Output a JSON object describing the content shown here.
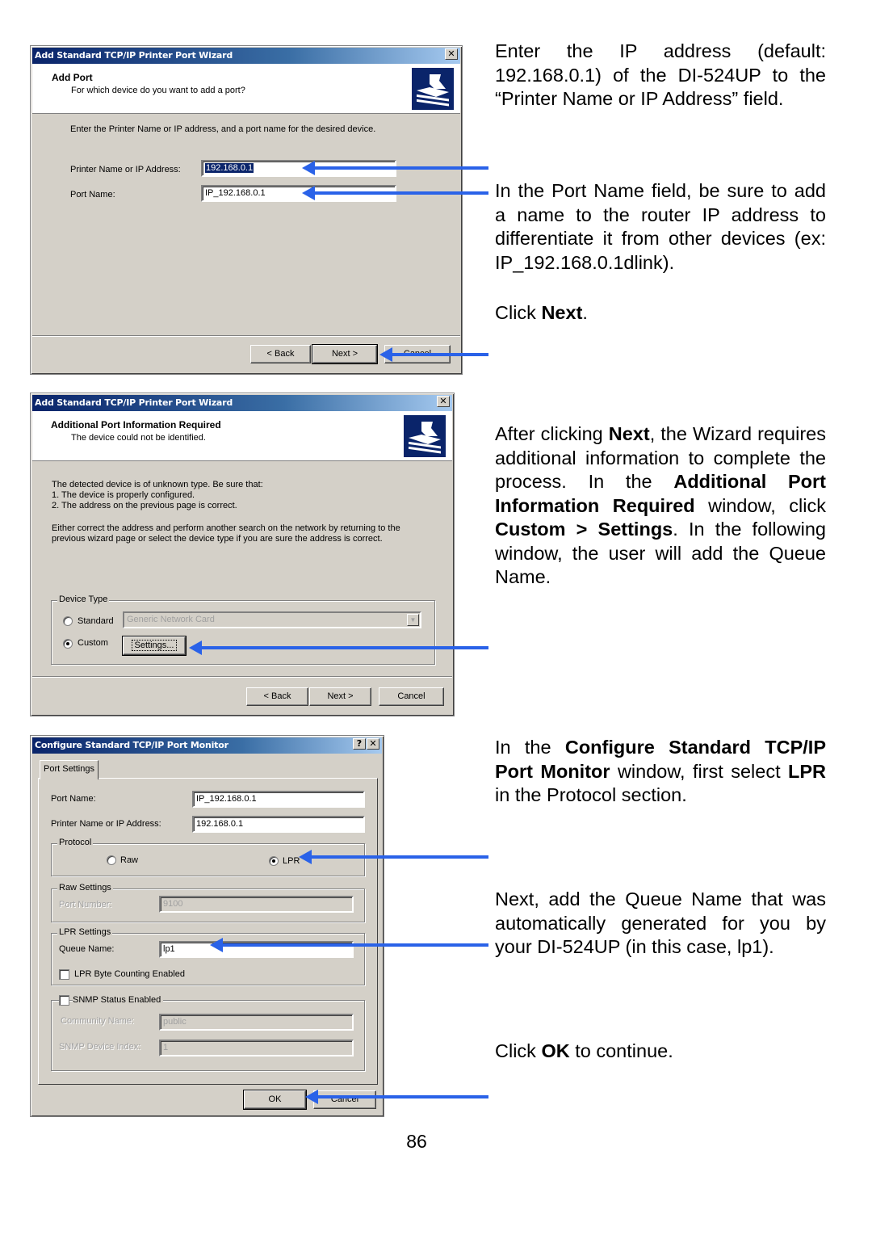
{
  "dialog1": {
    "title": "Add Standard TCP/IP Printer Port Wizard",
    "header_title": "Add Port",
    "header_subtitle": "For which device do you want to add a port?",
    "instruction": "Enter the Printer Name or IP address, and a port name for the desired device.",
    "printer_label": "Printer Name or IP Address:",
    "printer_value": "192.168.0.1",
    "port_label": "Port Name:",
    "port_value": "IP_192.168.0.1",
    "back_label": "< Back",
    "next_label": "Next >",
    "cancel_label": "Cancel",
    "close_icon": "close-icon"
  },
  "dialog2": {
    "title": "Add Standard TCP/IP Printer Port Wizard",
    "header_title": "Additional Port Information Required",
    "header_subtitle": "The device could not be identified.",
    "body_lines": [
      "The detected device is of unknown type.  Be sure that:",
      "1. The device is properly configured.",
      "2.  The address on the previous page is correct.",
      "Either correct the address and perform another search on the network by returning to the",
      "previous wizard page or select the device type if you are sure the address is correct."
    ],
    "device_type_label": "Device Type",
    "standard_label": "Standard",
    "standard_selected": false,
    "standard_combo_value": "Generic Network Card",
    "custom_label": "Custom",
    "custom_selected": true,
    "settings_label": "Settings...",
    "back_label": "< Back",
    "next_label": "Next >",
    "cancel_label": "Cancel"
  },
  "dialog3": {
    "title": "Configure Standard TCP/IP Port Monitor",
    "help_label": "?",
    "close_label": "X",
    "tab_label": "Port Settings",
    "port_name_label": "Port Name:",
    "port_name_value": "IP_192.168.0.1",
    "printer_label": "Printer Name or IP Address:",
    "printer_value": "192.168.0.1",
    "protocol_label": "Protocol",
    "raw_label": "Raw",
    "raw_selected": false,
    "lpr_label": "LPR",
    "lpr_selected": true,
    "raw_settings_label": "Raw Settings",
    "port_number_label": "Port Number:",
    "port_number_value": "9100",
    "lpr_settings_label": "LPR Settings",
    "queue_name_label": "Queue Name:",
    "queue_name_value": "lp1",
    "byte_counting_label": "LPR Byte Counting Enabled",
    "byte_counting_checked": false,
    "snmp_label": "SNMP Status Enabled",
    "snmp_checked": false,
    "community_label": "Community Name:",
    "community_value": "public",
    "device_index_label": "SNMP Device Index:",
    "device_index_value": "1",
    "ok_label": "OK",
    "cancel_label": "Cancel"
  },
  "instructions": {
    "p1": [
      "Enter the IP address (default: 192.168.0.1) of the DI-524UP to the “Printer Name or IP Address” field."
    ],
    "p2": "In the Port Name field, be sure to add a name to the router IP address to differentiate it from other devices (ex: IP_192.168.0.1dlink).",
    "p3_pre": "Click ",
    "p3_bold": "Next",
    "p3_post": ".",
    "p4": {
      "t1": "After clicking ",
      "b1": "Next",
      "t2": ", the Wizard requires additional information to complete the process. In the ",
      "b2": "Additional Port Information Required",
      "t3": " window, click ",
      "b3": "Custom > Settings",
      "t4": ". In the following window, the user will add the Queue Name."
    },
    "p5": {
      "t1": "In the ",
      "b1": "Configure Standard TCP/IP Port Monitor",
      "t2": " window, first select ",
      "b2": "LPR",
      "t3": " in the Protocol section."
    },
    "p6": "Next, add the Queue Name that was automatically generated for you by your DI-524UP (in this case, lp1).",
    "p7": {
      "t1": "Click ",
      "b1": "OK",
      "t2": " to continue."
    }
  },
  "arrow_color": "#2a62e8",
  "page_number": "86"
}
